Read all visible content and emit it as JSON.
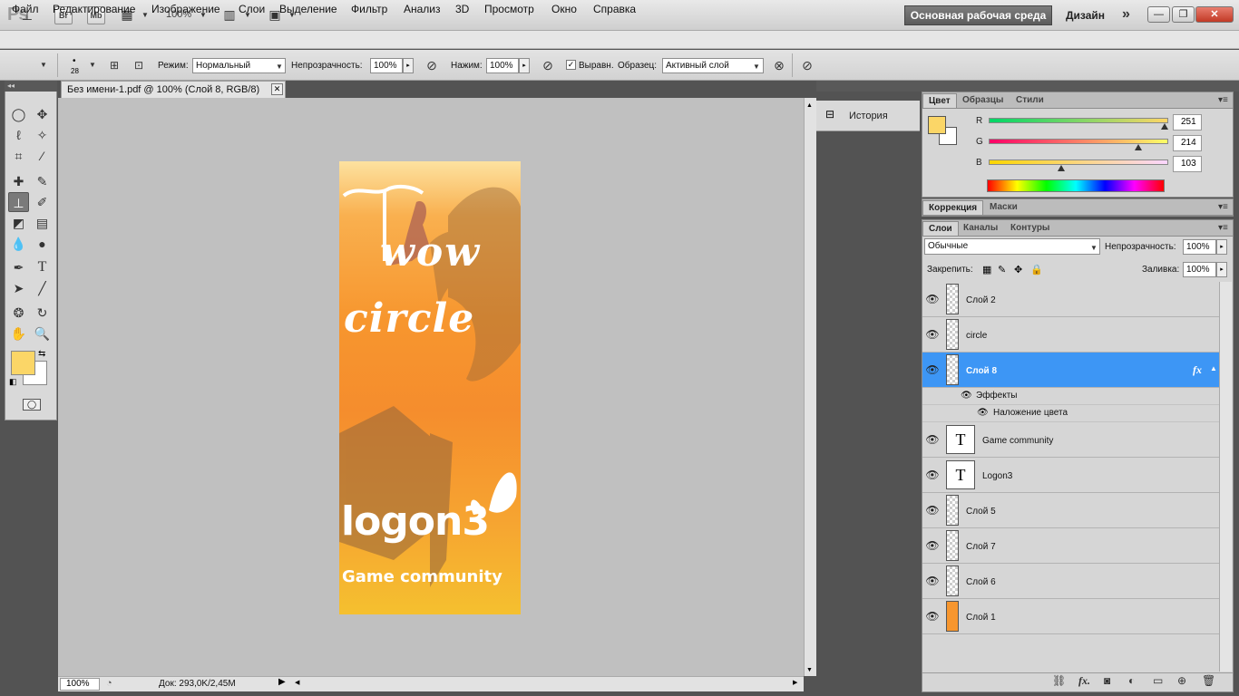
{
  "appbar": {
    "logo": "Ps",
    "bridge": "Br",
    "minibridge": "Mb",
    "zoom": "100%",
    "workspace": "Основная рабочая среда",
    "design": "Дизайн",
    "more": "»"
  },
  "menu": [
    "Файл",
    "Редактирование",
    "Изображение",
    "Слои",
    "Выделение",
    "Фильтр",
    "Анализ",
    "3D",
    "Просмотр",
    "Окно",
    "Справка"
  ],
  "options": {
    "brush_size": "28",
    "mode_label": "Режим:",
    "mode_value": "Нормальный",
    "opacity_label": "Непрозрачность:",
    "opacity_value": "100%",
    "pressure_label": "Нажим:",
    "pressure_value": "100%",
    "aligned_label": "Выравн.",
    "sample_label": "Образец:",
    "sample_value": "Активный слой"
  },
  "document": {
    "tab_title": "Без имени-1.pdf @ 100% (Слой 8, RGB/8)",
    "zoom": "100%",
    "info": "Док: 293,0K/2,45M"
  },
  "canvas": {
    "line1": "wow",
    "line2": "circle",
    "line3": "logon3",
    "line4": "Game community"
  },
  "history": {
    "label": "История"
  },
  "color_panel": {
    "tabs": [
      "Цвет",
      "Образцы",
      "Стили"
    ],
    "r_label": "R",
    "r_value": "251",
    "g_label": "G",
    "g_value": "214",
    "b_label": "B",
    "b_value": "103",
    "foreground": "#fbd667",
    "background": "#ffffff"
  },
  "adjust_panel": {
    "tabs": [
      "Коррекция",
      "Маски"
    ]
  },
  "layers_panel": {
    "tabs": [
      "Слои",
      "Каналы",
      "Контуры"
    ],
    "blend_mode": "Обычные",
    "opacity_label": "Непрозрачность:",
    "opacity_value": "100%",
    "lock_label": "Закрепить:",
    "fill_label": "Заливка:",
    "fill_value": "100%",
    "fx": "fx",
    "effects_label": "Эффекты",
    "color_overlay_label": "Наложение цвета",
    "layers": [
      {
        "name": "Слой 2",
        "type": "pixel"
      },
      {
        "name": "circle",
        "type": "pixel"
      },
      {
        "name": "Слой 8",
        "type": "pixel",
        "selected": true
      },
      {
        "name": "Game community",
        "type": "text"
      },
      {
        "name": "Logon3",
        "type": "text"
      },
      {
        "name": "Слой 5",
        "type": "pixel"
      },
      {
        "name": "Слой 7",
        "type": "pixel"
      },
      {
        "name": "Слой 6",
        "type": "pixel"
      },
      {
        "name": "Слой 1",
        "type": "fill"
      }
    ]
  },
  "colors": {
    "selection": "#3d96f5",
    "fill_layer": "#f7962e"
  }
}
